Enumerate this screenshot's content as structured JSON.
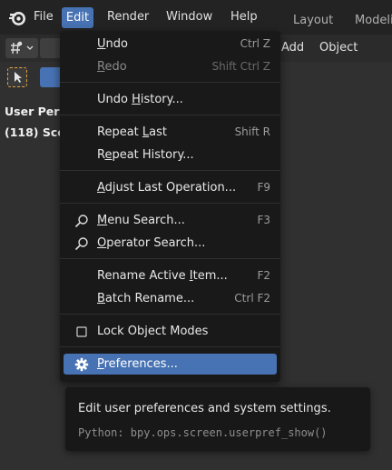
{
  "topbar": {
    "menus": [
      "File",
      "Edit",
      "Render",
      "Window",
      "Help"
    ],
    "workspace_tabs": [
      "Layout",
      "Modeli"
    ]
  },
  "header": {
    "add_label": "Add",
    "object_label": "Object"
  },
  "viewport": {
    "view_name": "User Pers",
    "scene_info": "(118) Sce"
  },
  "edit_menu": {
    "items": [
      {
        "label": "Undo",
        "underline": "U",
        "shortcut": "Ctrl Z"
      },
      {
        "label": "Redo",
        "underline": "R",
        "shortcut": "Shift Ctrl Z"
      },
      {
        "label": "Undo History...",
        "underline": "H",
        "shortcut": ""
      },
      {
        "label": "Repeat Last",
        "underline": "L",
        "shortcut": "Shift R"
      },
      {
        "label": "Repeat History...",
        "underline": "e",
        "shortcut": ""
      },
      {
        "label": "Adjust Last Operation...",
        "underline": "A",
        "shortcut": "F9"
      },
      {
        "label": "Menu Search...",
        "underline": "M",
        "shortcut": "F3"
      },
      {
        "label": "Operator Search...",
        "underline": "O",
        "shortcut": ""
      },
      {
        "label": "Rename Active Item...",
        "underline": "I",
        "shortcut": "F2"
      },
      {
        "label": "Batch Rename...",
        "underline": "B",
        "shortcut": "Ctrl F2"
      },
      {
        "label": "Lock Object Modes",
        "underline": "",
        "shortcut": ""
      },
      {
        "label": "Preferences...",
        "underline": "P",
        "shortcut": ""
      }
    ]
  },
  "tooltip": {
    "description": "Edit user preferences and system settings.",
    "python": "Python: bpy.ops.screen.userpref_show()"
  },
  "colors": {
    "accent": "#4772b3",
    "menu_bg": "#191919",
    "topbar_bg": "#232323",
    "workspace_bg": "#303030",
    "tool_outline": "#e8a33a"
  },
  "icons": {
    "app": "blender-logo-icon",
    "search": "search-icon",
    "checkbox": "checkbox-icon",
    "preferences": "gear-icon"
  }
}
